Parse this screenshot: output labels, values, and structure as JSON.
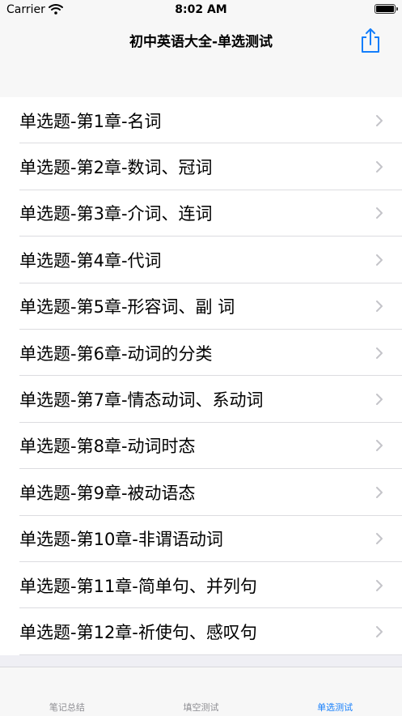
{
  "status_bar": {
    "carrier": "Carrier",
    "time": "8:02 AM",
    "battery_level": 1.0
  },
  "nav": {
    "title": "初中英语大全-单选测试",
    "share_icon": "share-icon",
    "accent_color": "#147efb"
  },
  "list": {
    "items": [
      {
        "label": "单选题-第1章-名词"
      },
      {
        "label": "单选题-第2章-数词、冠词"
      },
      {
        "label": "单选题-第3章-介词、连词"
      },
      {
        "label": "单选题-第4章-代词"
      },
      {
        "label": "单选题-第5章-形容词、副 词"
      },
      {
        "label": "单选题-第6章-动词的分类"
      },
      {
        "label": "单选题-第7章-情态动词、系动词"
      },
      {
        "label": "单选题-第8章-动词时态"
      },
      {
        "label": "单选题-第9章-被动语态"
      },
      {
        "label": "单选题-第10章-非谓语动词"
      },
      {
        "label": "单选题-第11章-简单句、并列句"
      },
      {
        "label": "单选题-第12章-祈使句、感叹句"
      }
    ]
  },
  "tabs": [
    {
      "label": "笔记总结",
      "active": false
    },
    {
      "label": "填空测试",
      "active": false
    },
    {
      "label": "单选测试",
      "active": true
    }
  ]
}
